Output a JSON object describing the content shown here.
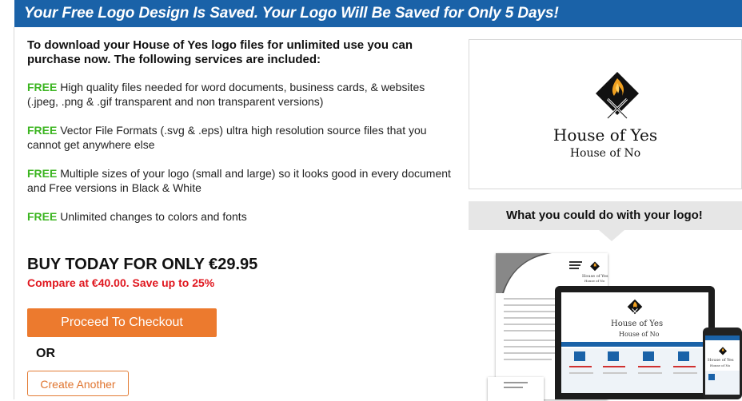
{
  "banner": {
    "text": "Your Free Logo Design Is Saved. Your Logo Will Be Saved for Only 5 Days!"
  },
  "intro": {
    "text": "To download your House of Yes logo files for unlimited use you can purchase now. The following services are included:"
  },
  "features": [
    {
      "badge": "FREE",
      "text": " High quality files needed for word documents, business cards, & websites (.jpeg, .png & .gif transparent and non transparent versions)"
    },
    {
      "badge": "FREE",
      "text": " Vector File Formats (.svg & .eps) ultra high resolution source files that you cannot get anywhere else"
    },
    {
      "badge": "FREE",
      "text": " Multiple sizes of your logo (small and large) so it looks good in every document and Free versions in Black & White"
    },
    {
      "badge": "FREE",
      "text": " Unlimited changes to colors and fonts"
    }
  ],
  "pricing": {
    "title": "BUY TODAY FOR ONLY €29.95",
    "compare": "Compare at €40.00. Save up to 25%"
  },
  "actions": {
    "checkout_label": "Proceed To Checkout",
    "or_label": "OR",
    "create_label": "Create Another"
  },
  "logo": {
    "name": "House of Yes",
    "tagline": "House of No",
    "accent": "#f0a020",
    "dark": "#111111"
  },
  "promo": {
    "heading": "What you could do with your logo!"
  },
  "colors": {
    "banner": "#1a62a8",
    "free": "#3cb521",
    "price_red": "#e0171f",
    "button_orange": "#ec7a2e"
  }
}
